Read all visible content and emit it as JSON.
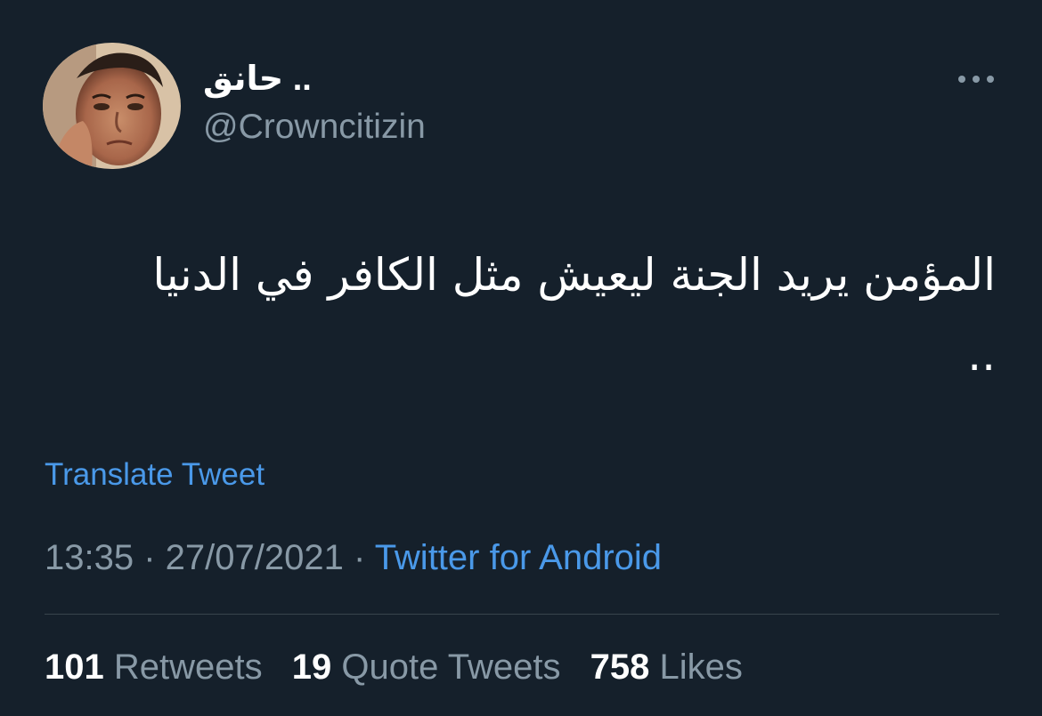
{
  "colors": {
    "background": "#15202b",
    "primary_text": "#ffffff",
    "secondary_text": "#8899a6",
    "link": "#4a99e9",
    "divider": "#38444d"
  },
  "author": {
    "display_name": "حانق ..",
    "handle": "@Crowncitizin",
    "avatar_icon": "user-avatar-photo"
  },
  "more_icon": "more-options-icon",
  "tweet": {
    "text": "المؤمن يريد الجنة ليعيش مثل الكافر في الدنيا .."
  },
  "translate_label": "Translate Tweet",
  "meta": {
    "time": "13:35",
    "separator_1": " · ",
    "date": "27/07/2021",
    "separator_2": " · ",
    "source": "Twitter for Android"
  },
  "stats": {
    "retweets_count": "101",
    "retweets_label": "Retweets",
    "quotes_count": "19",
    "quotes_label": "Quote Tweets",
    "likes_count": "758",
    "likes_label": "Likes"
  }
}
